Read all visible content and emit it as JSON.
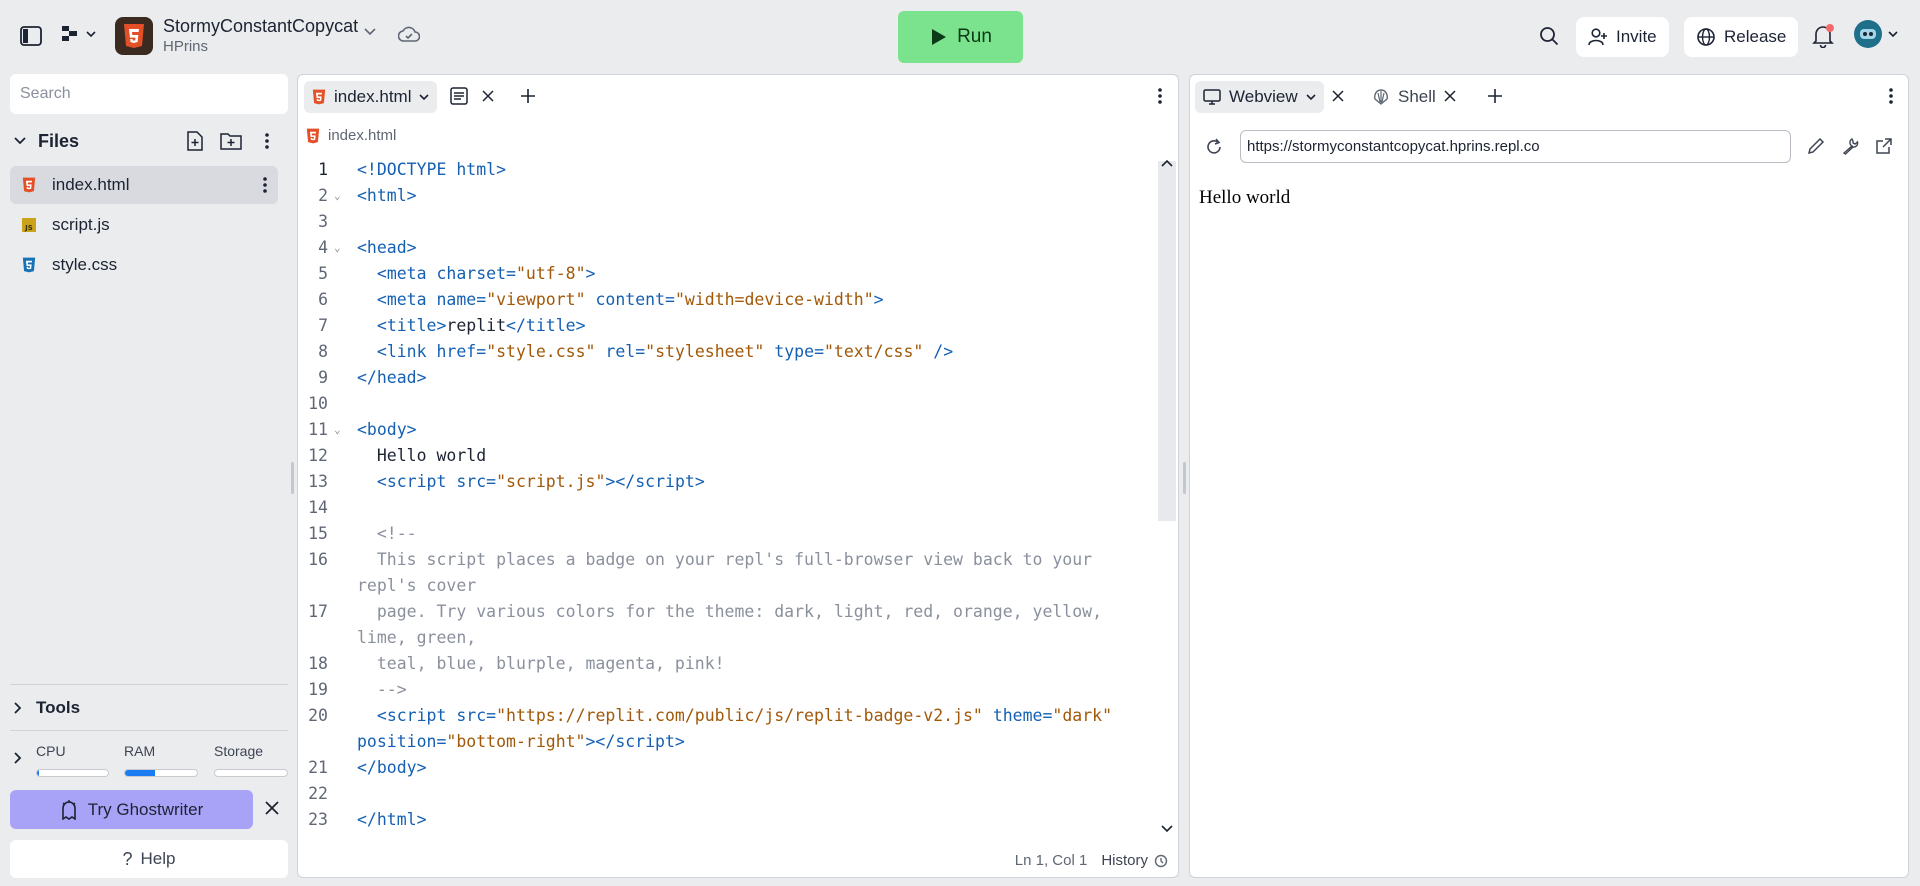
{
  "topbar": {
    "repl_name": "StormyConstantCopycat",
    "repl_owner": "HPrins",
    "run_label": "Run",
    "invite_label": "Invite",
    "release_label": "Release"
  },
  "sidebar": {
    "search_placeholder": "Search",
    "files_header": "Files",
    "files": [
      {
        "name": "index.html",
        "icon": "html5-icon",
        "active": true
      },
      {
        "name": "script.js",
        "icon": "js-icon",
        "active": false
      },
      {
        "name": "style.css",
        "icon": "css3-icon",
        "active": false
      }
    ],
    "tools_label": "Tools",
    "resources": {
      "cpu_label": "CPU",
      "ram_label": "RAM",
      "storage_label": "Storage",
      "cpu_usage": 0.03,
      "ram_usage": 0.42,
      "storage_usage": 0.0
    },
    "ghostwriter_label": "Try Ghostwriter",
    "help_label": "Help"
  },
  "editor": {
    "tab_label": "index.html",
    "breadcrumb": "index.html",
    "cursor_position": "Ln 1, Col 1",
    "history_label": "History",
    "lines": [
      {
        "n": "1",
        "fold": false
      },
      {
        "n": "2",
        "fold": true
      },
      {
        "n": "3",
        "fold": false
      },
      {
        "n": "4",
        "fold": true
      },
      {
        "n": "5",
        "fold": false
      },
      {
        "n": "6",
        "fold": false
      },
      {
        "n": "7",
        "fold": false
      },
      {
        "n": "8",
        "fold": false
      },
      {
        "n": "9",
        "fold": false
      },
      {
        "n": "10",
        "fold": false
      },
      {
        "n": "11",
        "fold": true
      },
      {
        "n": "12",
        "fold": false
      },
      {
        "n": "13",
        "fold": false
      },
      {
        "n": "14",
        "fold": false
      },
      {
        "n": "15",
        "fold": false
      },
      {
        "n": "16",
        "fold": false
      },
      {
        "n": "17",
        "fold": false
      },
      {
        "n": "18",
        "fold": false
      },
      {
        "n": "19",
        "fold": false
      },
      {
        "n": "20",
        "fold": false
      },
      {
        "n": "21",
        "fold": false
      },
      {
        "n": "22",
        "fold": false
      },
      {
        "n": "23",
        "fold": false
      }
    ],
    "code": {
      "l1": [
        "<!DOCTYPE html>"
      ],
      "l2": [
        "<html>"
      ],
      "l4": [
        "<head>"
      ],
      "l5": [
        "  <",
        "meta",
        " ",
        "charset",
        "=",
        "\"utf-8\"",
        ">"
      ],
      "l6": [
        "  <",
        "meta",
        " ",
        "name",
        "=",
        "\"viewport\"",
        " ",
        "content",
        "=",
        "\"width=device-width\"",
        ">"
      ],
      "l7": [
        "  <",
        "title",
        ">",
        "replit",
        "</",
        "title",
        ">"
      ],
      "l8": [
        "  <",
        "link",
        " ",
        "href",
        "=",
        "\"style.css\"",
        " ",
        "rel",
        "=",
        "\"stylesheet\"",
        " ",
        "type",
        "=",
        "\"text/css\"",
        " />"
      ],
      "l9": [
        "</head>"
      ],
      "l11": [
        "<body>"
      ],
      "l12": [
        "  Hello world"
      ],
      "l13": [
        "  <",
        "script",
        " ",
        "src",
        "=",
        "\"script.js\"",
        "></",
        "script",
        ">"
      ],
      "l15": [
        "  <!--"
      ],
      "l16": [
        "  This script places a badge on your repl's full-browser view back to your repl's cover"
      ],
      "l17": [
        "  page. Try various colors for the theme: dark, light, red, orange, yellow, lime, green,"
      ],
      "l18": [
        "  teal, blue, blurple, magenta, pink!"
      ],
      "l19": [
        "  -->"
      ],
      "l20": [
        "  <",
        "script",
        " ",
        "src",
        "=",
        "\"https://replit.com/public/js/replit-badge-v2.js\"",
        " ",
        "theme",
        "=",
        "\"dark\"",
        " ",
        "position",
        "=",
        "\"bottom-right\"",
        "></",
        "script",
        ">"
      ],
      "l21": [
        "</body>"
      ],
      "l23": [
        "</html>"
      ]
    }
  },
  "webview": {
    "tab_label": "Webview",
    "shell_tab_label": "Shell",
    "url": "https://stormyconstantcopycat.hprins.repl.co",
    "content": "Hello world"
  },
  "colors": {
    "run_button": "#7be28d",
    "ghostwriter": "#a9a3f7",
    "html_icon": "#e34f26",
    "js_icon": "#c9a41b",
    "css_icon": "#1572b6",
    "code_tag": "#1560b3",
    "code_string": "#a15808",
    "code_comment": "#8a909c"
  }
}
